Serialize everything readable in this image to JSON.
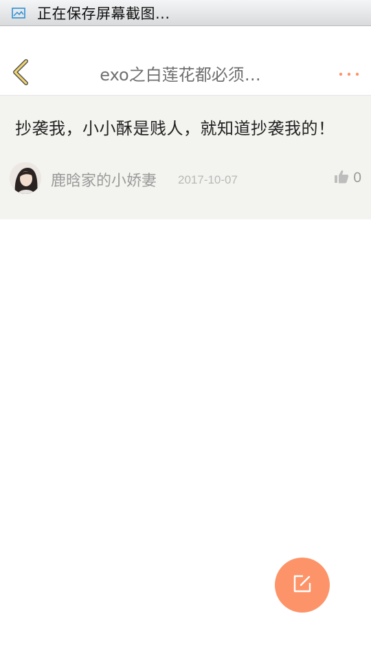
{
  "status_bar": {
    "icon": "image-icon",
    "text": "正在保存屏幕截图..."
  },
  "nav": {
    "back_icon": "chevron-left-icon",
    "title": "exo之白莲花都必须…",
    "more_icon": "more-dots-icon"
  },
  "post": {
    "content": "抄袭我，小小酥是贱人，就知道抄袭我的！",
    "author": "鹿晗家的小娇妻",
    "date": "2017-10-07",
    "like_icon": "thumbs-up-icon",
    "like_count": "0"
  },
  "fab": {
    "icon": "edit-icon"
  },
  "colors": {
    "accent": "#fd9469",
    "back_arrow": "#f5d76e",
    "card_bg": "#f3f3ef"
  }
}
